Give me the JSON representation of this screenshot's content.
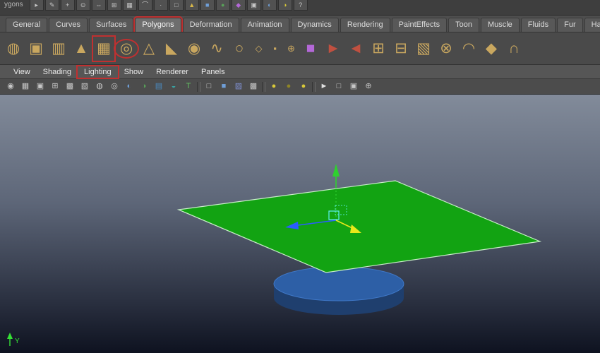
{
  "window": {
    "menuset_label": "ygons"
  },
  "topbar": {
    "icons": [
      {
        "name": "select-tool-icon",
        "glyph": "▸"
      },
      {
        "name": "lasso-tool-icon",
        "glyph": "✎"
      },
      {
        "name": "paint-select-icon",
        "glyph": "+"
      },
      {
        "name": "move-tool-icon",
        "glyph": "⊙"
      },
      {
        "name": "rotate-tool-icon",
        "glyph": "⇔"
      },
      {
        "name": "scale-tool-icon",
        "glyph": "⊞"
      },
      {
        "name": "snap-grid-icon",
        "glyph": "▦"
      },
      {
        "name": "snap-curve-icon",
        "glyph": "⌒"
      },
      {
        "name": "snap-point-icon",
        "glyph": "∙"
      },
      {
        "name": "snap-plane-icon",
        "glyph": "□"
      },
      {
        "name": "construction-history-icon",
        "glyph": "▲",
        "color": "#d8b84a"
      },
      {
        "name": "render-view-icon",
        "glyph": "■",
        "color": "#6f9fd8"
      },
      {
        "name": "render-current-icon",
        "glyph": "●",
        "color": "#58a058"
      },
      {
        "name": "ipr-render-icon",
        "glyph": "◆",
        "color": "#b468d8"
      },
      {
        "name": "render-settings-icon",
        "glyph": "▣"
      },
      {
        "name": "paint-effects-icon",
        "glyph": "◐",
        "color": "#6f9fd8"
      },
      {
        "name": "hypershade-icon",
        "glyph": "◑",
        "color": "#d8c83a"
      },
      {
        "name": "help-icon",
        "glyph": "?"
      }
    ]
  },
  "shelf_tabs": {
    "tabs": [
      {
        "name": "shelf-tab-general",
        "label": "General"
      },
      {
        "name": "shelf-tab-curves",
        "label": "Curves"
      },
      {
        "name": "shelf-tab-surfaces",
        "label": "Surfaces"
      },
      {
        "name": "shelf-tab-polygons",
        "label": "Polygons",
        "cls": "active annotate-box"
      },
      {
        "name": "shelf-tab-deformation",
        "label": "Deformation"
      },
      {
        "name": "shelf-tab-animation",
        "label": "Animation"
      },
      {
        "name": "shelf-tab-dynamics",
        "label": "Dynamics"
      },
      {
        "name": "shelf-tab-rendering",
        "label": "Rendering"
      },
      {
        "name": "shelf-tab-painteffects",
        "label": "PaintEffects"
      },
      {
        "name": "shelf-tab-toon",
        "label": "Toon"
      },
      {
        "name": "shelf-tab-muscle",
        "label": "Muscle"
      },
      {
        "name": "shelf-tab-fluids",
        "label": "Fluids"
      },
      {
        "name": "shelf-tab-fur",
        "label": "Fur"
      },
      {
        "name": "shelf-tab-hair",
        "label": "Hair"
      }
    ]
  },
  "shelf": {
    "icons": [
      {
        "name": "poly-sphere-icon",
        "glyph": "◍"
      },
      {
        "name": "poly-cube-icon",
        "glyph": "▣"
      },
      {
        "name": "poly-cylinder-icon",
        "glyph": "▥"
      },
      {
        "name": "poly-cone-icon",
        "glyph": "▲"
      },
      {
        "name": "poly-plane-icon",
        "glyph": "▦",
        "cls": "annotate-box"
      },
      {
        "name": "poly-torus-icon",
        "glyph": "◎",
        "cls": "annotate-oval"
      },
      {
        "name": "poly-prism-icon",
        "glyph": "△"
      },
      {
        "name": "poly-pyramid-icon",
        "glyph": "◣"
      },
      {
        "name": "poly-pipe-icon",
        "glyph": "◉"
      },
      {
        "name": "poly-helix-icon",
        "glyph": "∿"
      },
      {
        "name": "poly-soccer-ball-icon",
        "glyph": "○"
      },
      {
        "name": "poly-platonic-icon",
        "glyph": "◇",
        "cls": "small"
      },
      {
        "name": "sculpt-geometry-icon",
        "glyph": "▪",
        "cls": "small"
      },
      {
        "name": "mirror-geometry-icon",
        "glyph": "⊕",
        "cls": "small"
      },
      {
        "name": "texture-cube-icon",
        "glyph": "■",
        "color": "#b468d8"
      },
      {
        "name": "select-faces-icon",
        "glyph": "►",
        "color": "#c05040"
      },
      {
        "name": "append-polygon-icon",
        "glyph": "◄",
        "color": "#c05040"
      },
      {
        "name": "combine-icon",
        "glyph": "⊞"
      },
      {
        "name": "separate-icon",
        "glyph": "⊟"
      },
      {
        "name": "extract-icon",
        "glyph": "▧"
      },
      {
        "name": "booleans-icon",
        "glyph": "⊗"
      },
      {
        "name": "smooth-icon",
        "glyph": "◠"
      },
      {
        "name": "bevel-icon",
        "glyph": "◆"
      },
      {
        "name": "bridge-icon",
        "glyph": "∩"
      }
    ]
  },
  "panel_menu": {
    "items": [
      {
        "name": "panel-menu-view",
        "label": "View"
      },
      {
        "name": "panel-menu-shading",
        "label": "Shading"
      },
      {
        "name": "panel-menu-lighting",
        "label": "Lighting",
        "cls": "annotate-box"
      },
      {
        "name": "panel-menu-show",
        "label": "Show"
      },
      {
        "name": "panel-menu-renderer",
        "label": "Renderer"
      },
      {
        "name": "panel-menu-panels",
        "label": "Panels"
      }
    ]
  },
  "panel_toolbar": {
    "icons": [
      {
        "name": "select-camera-icon",
        "glyph": "◉"
      },
      {
        "name": "grid-toggle-icon",
        "glyph": "▦"
      },
      {
        "name": "film-gate-icon",
        "glyph": "▣"
      },
      {
        "name": "resolution-gate-icon",
        "glyph": "⊞"
      },
      {
        "name": "gate-mask-icon",
        "glyph": "▩"
      },
      {
        "name": "field-chart-icon",
        "glyph": "▧"
      },
      {
        "name": "safe-action-icon",
        "glyph": "◍"
      },
      {
        "name": "safe-title-icon",
        "glyph": "◎"
      },
      {
        "name": "camera-attributes-icon",
        "glyph": "◐",
        "color": "#6f9fd8"
      },
      {
        "name": "bookmarks-icon",
        "glyph": "◑",
        "color": "#58a058"
      },
      {
        "name": "image-plane-icon",
        "glyph": "▤",
        "color": "#4a8ac0"
      },
      {
        "name": "pan-zoom-icon",
        "glyph": "◒",
        "color": "#3aa0a0"
      },
      {
        "name": "hud-icon",
        "glyph": "T",
        "color": "#62c062"
      },
      {
        "name": "toolbar-separator",
        "glyph": "",
        "cls": "sep",
        "interactable": false
      },
      {
        "name": "wireframe-mode-icon",
        "glyph": "□"
      },
      {
        "name": "shaded-mode-icon",
        "glyph": "■",
        "color": "#6f9fd8"
      },
      {
        "name": "textured-mode-icon",
        "glyph": "▨",
        "color": "#7f8fd0"
      },
      {
        "name": "checker-mode-icon",
        "glyph": "▩"
      },
      {
        "name": "toolbar-separator",
        "glyph": "",
        "cls": "sep",
        "interactable": false
      },
      {
        "name": "lighting-all-icon",
        "glyph": "●",
        "color": "#d8c83a"
      },
      {
        "name": "lighting-default-icon",
        "glyph": "●",
        "color": "#8f8526"
      },
      {
        "name": "lighting-selected-icon",
        "glyph": "●",
        "color": "#d8c83a"
      },
      {
        "name": "toolbar-separator",
        "glyph": "",
        "cls": "sep",
        "interactable": false
      },
      {
        "name": "select-cursor-icon",
        "glyph": "►",
        "color": "#e0e0e0"
      },
      {
        "name": "isolate-view-icon",
        "glyph": "□"
      },
      {
        "name": "isolate-add-icon",
        "glyph": "▣"
      },
      {
        "name": "share-view-icon",
        "glyph": "⊕"
      }
    ]
  },
  "viewport": {
    "axis_label": "Y",
    "colors": {
      "plane": "#12a312",
      "plane_edge": "#c8eec8",
      "disc_top": "#2d5fa6",
      "disc_side": "#1f3f6e",
      "disc_edge": "#3f78c8",
      "arrow_y": "#2fd12f",
      "arrow_x": "#2b5cff",
      "arrow_z": "#e8e81a",
      "center": "#5ff2f2",
      "axis": "#35e035"
    }
  }
}
